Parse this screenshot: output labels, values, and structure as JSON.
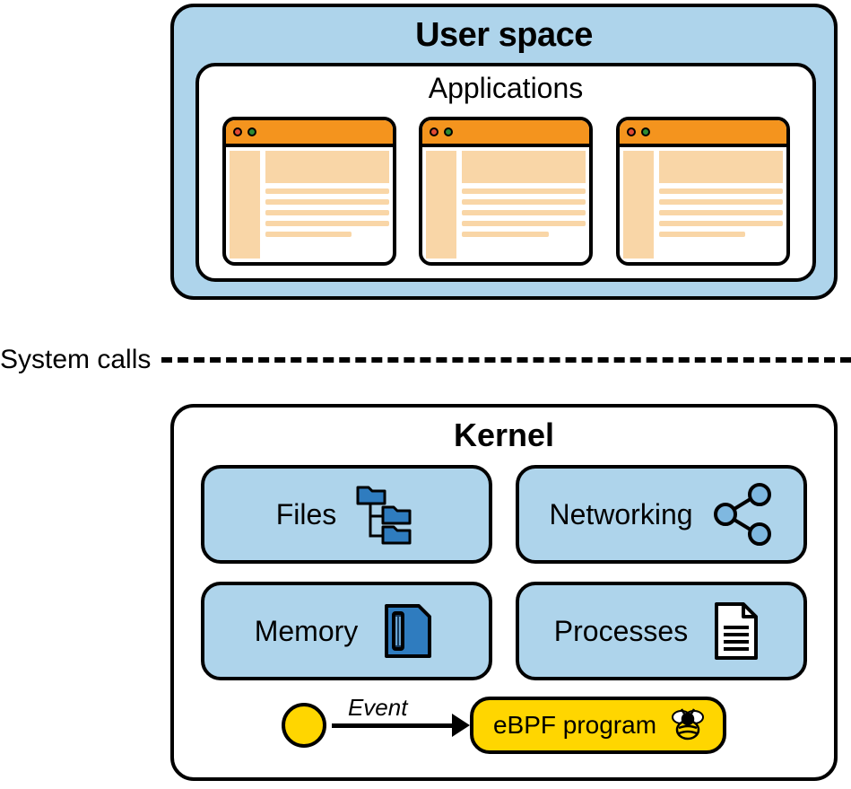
{
  "user_space": {
    "title": "User space",
    "applications_label": "Applications"
  },
  "divider": {
    "label": "System calls"
  },
  "kernel": {
    "title": "Kernel",
    "subsystems": {
      "files": "Files",
      "networking": "Networking",
      "memory": "Memory",
      "processes": "Processes"
    },
    "event_label": "Event",
    "ebpf_label": "eBPF program"
  }
}
